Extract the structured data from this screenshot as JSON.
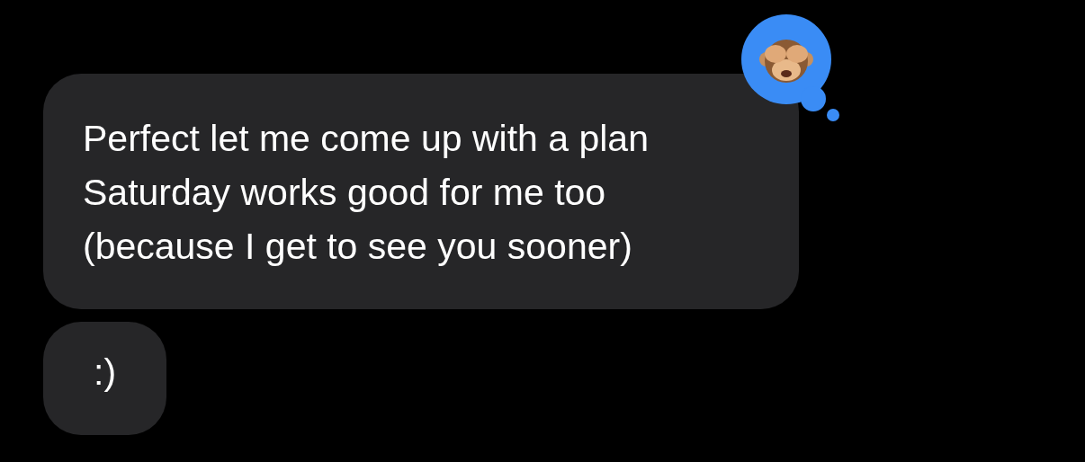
{
  "messages": [
    {
      "text": "Perfect let me come up with a plan Saturday works good for me too (because I get to see you sooner)",
      "reaction": {
        "kind": "monkey"
      }
    },
    {
      "text": ":)"
    }
  ]
}
